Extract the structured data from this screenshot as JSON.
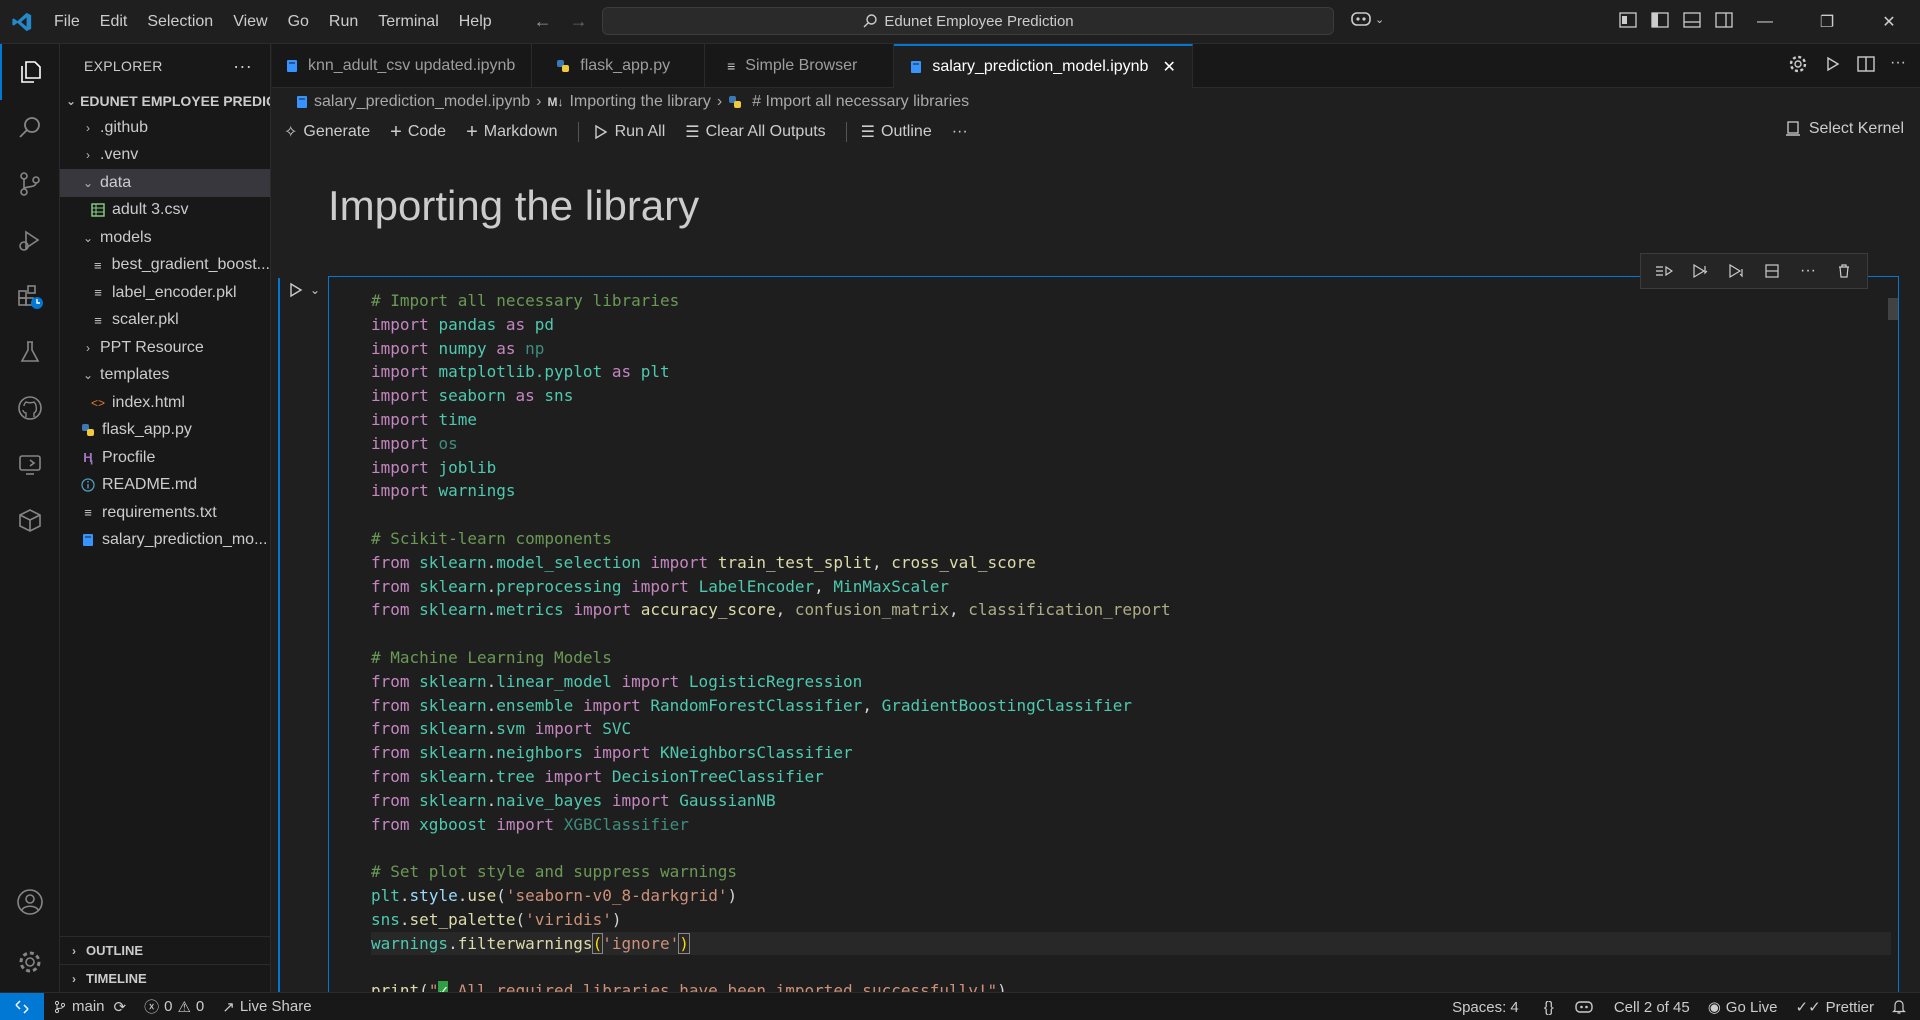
{
  "menu": [
    "File",
    "Edit",
    "Selection",
    "View",
    "Go",
    "Run",
    "Terminal",
    "Help"
  ],
  "search": {
    "label": "Edunet Employee Prediction"
  },
  "sidebar": {
    "title": "EXPLORER",
    "root": "EDUNET EMPLOYEE PREDICI...",
    "items": [
      {
        "label": ".github",
        "kind": "folder",
        "depth": 1
      },
      {
        "label": ".venv",
        "kind": "folder",
        "depth": 1
      },
      {
        "label": "data",
        "kind": "folder-open",
        "depth": 1
      },
      {
        "label": "adult 3.csv",
        "kind": "csv",
        "depth": 2
      },
      {
        "label": "models",
        "kind": "folder-open",
        "depth": 1
      },
      {
        "label": "best_gradient_boost...",
        "kind": "file",
        "depth": 2
      },
      {
        "label": "label_encoder.pkl",
        "kind": "file",
        "depth": 2
      },
      {
        "label": "scaler.pkl",
        "kind": "file",
        "depth": 2
      },
      {
        "label": "PPT Resource",
        "kind": "folder",
        "depth": 1
      },
      {
        "label": "templates",
        "kind": "folder-open",
        "depth": 1
      },
      {
        "label": "index.html",
        "kind": "html",
        "depth": 2
      },
      {
        "label": "flask_app.py",
        "kind": "python",
        "depth": 1
      },
      {
        "label": "Procfile",
        "kind": "procfile",
        "depth": 1
      },
      {
        "label": "README.md",
        "kind": "info",
        "depth": 1
      },
      {
        "label": "requirements.txt",
        "kind": "text",
        "depth": 1
      },
      {
        "label": "salary_prediction_mo...",
        "kind": "notebook",
        "depth": 1
      }
    ],
    "outline": "OUTLINE",
    "timeline": "TIMELINE"
  },
  "tabs": [
    {
      "label": "knn_adult_csv updated.ipynb",
      "icon": "notebook-icon"
    },
    {
      "label": "flask_app.py",
      "icon": "python-icon"
    },
    {
      "label": "Simple Browser",
      "icon": "browser-icon"
    },
    {
      "label": "salary_prediction_model.ipynb",
      "icon": "notebook-icon",
      "active": true
    }
  ],
  "breadcrumb": {
    "file": "salary_prediction_model.ipynb",
    "section_badge": "M↓",
    "section": "Importing the library",
    "cell": "# Import all necessary libraries"
  },
  "toolbar": {
    "generate": "Generate",
    "code": "Code",
    "markdown": "Markdown",
    "run_all": "Run All",
    "clear_outputs": "Clear All Outputs",
    "outline": "Outline",
    "more": "···",
    "select_kernel": "Select Kernel"
  },
  "notebook": {
    "heading": "Importing the library"
  },
  "status": {
    "branch": "main",
    "errors": "0",
    "warnings": "0",
    "live_share": "Live Share",
    "spaces": "Spaces: 4",
    "braces": "{}",
    "cell_pos": "Cell 2 of 45",
    "go_live": "Go Live",
    "prettier": "Prettier"
  },
  "colors": {
    "accent": "#0078d4",
    "comment": "#6a9955",
    "keyword": "#c586c0",
    "module": "#4ec9b0",
    "function": "#dcdcaa",
    "string": "#ce9178"
  }
}
